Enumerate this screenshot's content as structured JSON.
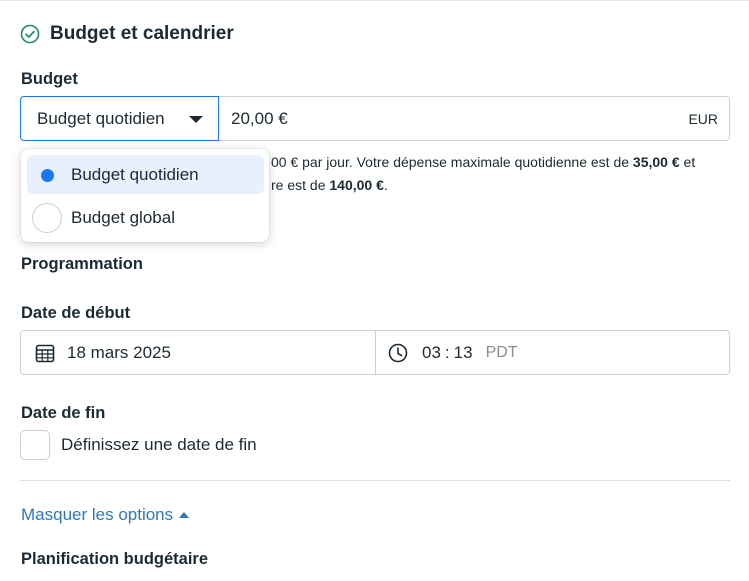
{
  "section": {
    "title": "Budget et calendrier"
  },
  "budget": {
    "label": "Budget",
    "type_selected": "Budget quotidien",
    "amount": "20,00 €",
    "currency": "EUR",
    "help_line1_part1": "00 € par jour. Votre dépense maximale quotidienne est de ",
    "help_line1_bold": "35,00 €",
    "help_line1_part2": " et",
    "help_line2_part1": "re est de ",
    "help_line2_bold": "140,00 €",
    "help_line2_part2": "."
  },
  "dropdown": {
    "options": [
      {
        "label": "Budget quotidien",
        "selected": true
      },
      {
        "label": "Budget global",
        "selected": false
      }
    ]
  },
  "schedule": {
    "label": "Programmation",
    "start_label": "Date de début",
    "start_date": "18 mars 2025",
    "start_hour": "03",
    "start_minute": "13",
    "timezone": "PDT",
    "end_label": "Date de fin",
    "end_checkbox_label": "Définissez une date de fin"
  },
  "options_toggle": "Masquer les options",
  "budget_planning": {
    "label": "Planification budgétaire"
  },
  "icons": {
    "check": "check-circle-icon",
    "calendar": "calendar-icon",
    "clock": "clock-icon",
    "caret_down": "caret-down-icon",
    "caret_up": "caret-up-icon"
  },
  "colors": {
    "accent": "#1877f2",
    "link": "#2d79b8",
    "check": "#1e8e5a",
    "text": "#1c2b33",
    "muted": "#8a8d91",
    "selected_bg": "#e7f0fc"
  }
}
